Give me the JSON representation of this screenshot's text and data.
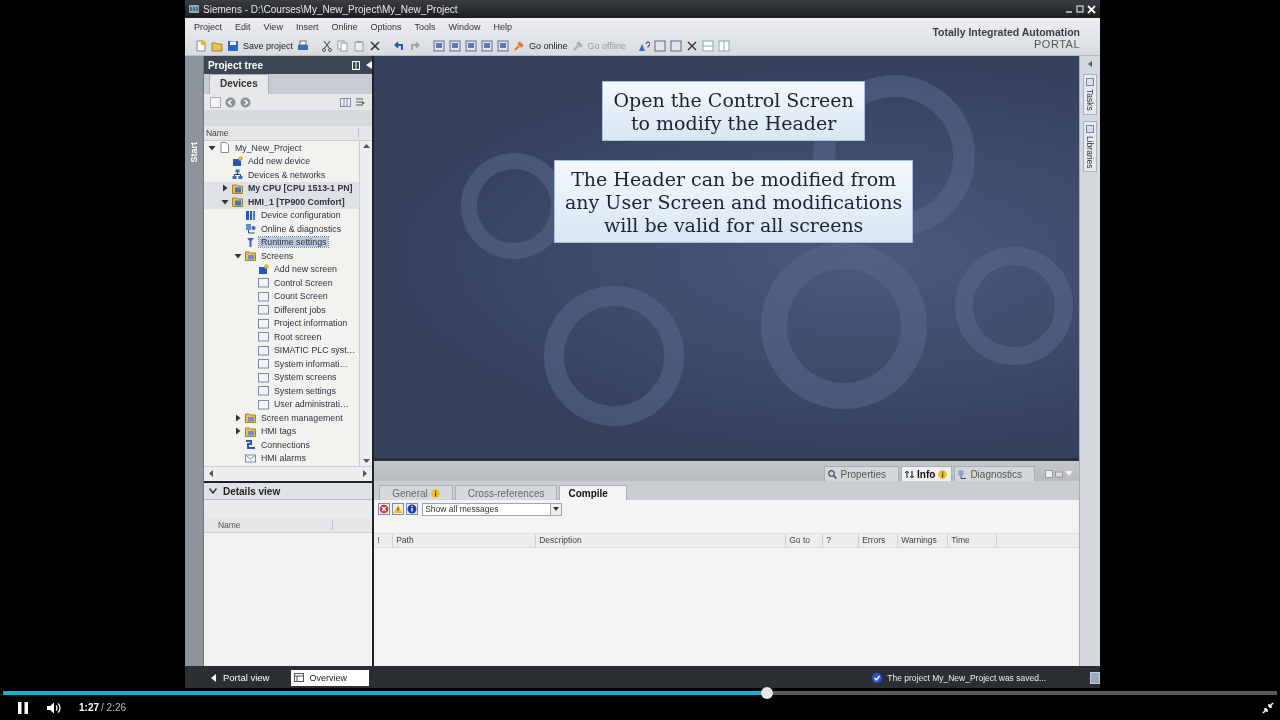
{
  "window": {
    "title": "Siemens - D:\\Courses\\My_New_Project\\My_New_Project"
  },
  "menu": [
    "Project",
    "Edit",
    "View",
    "Insert",
    "Online",
    "Options",
    "Tools",
    "Window",
    "Help"
  ],
  "toolbar": [
    {
      "label": "Save project",
      "disabled": false
    },
    {
      "label": "Go online",
      "disabled": false
    },
    {
      "label": "Go offline",
      "disabled": true
    }
  ],
  "brand": {
    "line1": "Totally Integrated Automation",
    "line2": "PORTAL"
  },
  "side_tab": "Start",
  "project_tree": {
    "title": "Project tree",
    "tab": "Devices",
    "column": "Name",
    "items": [
      {
        "label": "My_New_Project",
        "kind": "project",
        "expanded": true,
        "selected": false,
        "children": [
          {
            "label": "Add new device",
            "kind": "add-device",
            "selected": false
          },
          {
            "label": "Devices & networks",
            "kind": "network",
            "selected": false
          },
          {
            "label": "My CPU [CPU 1513-1 PN]",
            "kind": "device",
            "expanded": false,
            "selected": false
          },
          {
            "label": "HMI_1 [TP900 Comfort]",
            "kind": "device",
            "expanded": true,
            "selected": false,
            "children": [
              {
                "label": "Device configuration",
                "kind": "config",
                "selected": false
              },
              {
                "label": "Online & diagnostics",
                "kind": "diag",
                "selected": false
              },
              {
                "label": "Runtime settings",
                "kind": "runtime",
                "selected": true
              },
              {
                "label": "Screens",
                "kind": "folder",
                "expanded": true,
                "selected": false,
                "children": [
                  {
                    "label": "Add new screen",
                    "kind": "add-screen",
                    "selected": false
                  },
                  {
                    "label": "Control Screen",
                    "kind": "screen",
                    "selected": false
                  },
                  {
                    "label": "Count Screen",
                    "kind": "screen",
                    "selected": false
                  },
                  {
                    "label": "Different jobs",
                    "kind": "screen",
                    "selected": false
                  },
                  {
                    "label": "Project information",
                    "kind": "screen",
                    "selected": false
                  },
                  {
                    "label": "Root screen",
                    "kind": "screen",
                    "selected": false
                  },
                  {
                    "label": "SIMATIC PLC syst…",
                    "kind": "screen",
                    "selected": false
                  },
                  {
                    "label": "System informati…",
                    "kind": "screen",
                    "selected": false
                  },
                  {
                    "label": "System screens",
                    "kind": "screen",
                    "selected": false
                  },
                  {
                    "label": "System settings",
                    "kind": "screen",
                    "selected": false
                  },
                  {
                    "label": "User administrati…",
                    "kind": "screen",
                    "selected": false
                  }
                ]
              },
              {
                "label": "Screen management",
                "kind": "folder",
                "expanded": false,
                "selected": false
              },
              {
                "label": "HMI tags",
                "kind": "folder",
                "expanded": false,
                "selected": false
              },
              {
                "label": "Connections",
                "kind": "connections",
                "selected": false
              },
              {
                "label": "HMI alarms",
                "kind": "alarms",
                "selected": false
              }
            ]
          }
        ]
      }
    ]
  },
  "details_view": {
    "title": "Details view",
    "column": "Name"
  },
  "callouts": [
    "Open the Control Screen\nto modify the Header",
    "The Header can be modified from\nany User Screen and modifications\nwill be valid for all screens"
  ],
  "right_tabs": [
    "Tasks",
    "Libraries"
  ],
  "inspector": {
    "top_tabs": [
      {
        "label": "Properties",
        "selected": false
      },
      {
        "label": "Info",
        "selected": true
      },
      {
        "label": "Diagnostics",
        "selected": false
      }
    ],
    "tabs": [
      {
        "label": "General",
        "selected": false
      },
      {
        "label": "Cross-references",
        "selected": false
      },
      {
        "label": "Compile",
        "selected": true
      }
    ],
    "filter": "Show all messages",
    "columns": [
      "!",
      "Path",
      "Description",
      "Go to",
      "?",
      "Errors",
      "Warnings",
      "Time"
    ]
  },
  "status_bar": {
    "portal_view": "Portal view",
    "overview": "Overview",
    "message": "The project My_New_Project was saved..."
  },
  "player": {
    "playing": true,
    "level": 0.6,
    "time": "1:27",
    "duration": "/ 2:26"
  }
}
